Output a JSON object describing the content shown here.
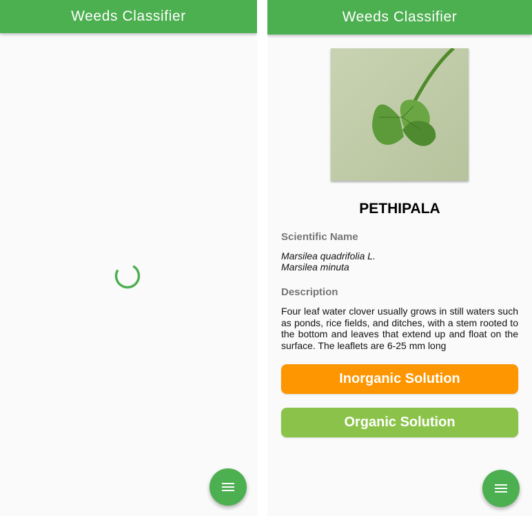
{
  "app": {
    "title": "Weeds Classifier"
  },
  "loading_screen": {
    "menu_icon": "menu-icon"
  },
  "detail_screen": {
    "weed_name": "PETHIPALA",
    "scientific_name_label": "Scientific Name",
    "scientific_names": [
      "Marsilea quadrifolia L.",
      "Marsilea minuta"
    ],
    "description_label": "Description",
    "description": "Four leaf water clover usually grows in still waters such as ponds, rice fields, and ditches, with a stem rooted to the bottom and leaves that extend up and float on the surface. The leaflets are 6-25 mm long",
    "inorganic_button": "Inorganic Solution",
    "organic_button": "Organic Solution",
    "menu_icon": "menu-icon"
  },
  "colors": {
    "primary": "#4caf50",
    "inorganic": "#fd9600",
    "organic": "#8bc34a",
    "label_gray": "#757575"
  }
}
